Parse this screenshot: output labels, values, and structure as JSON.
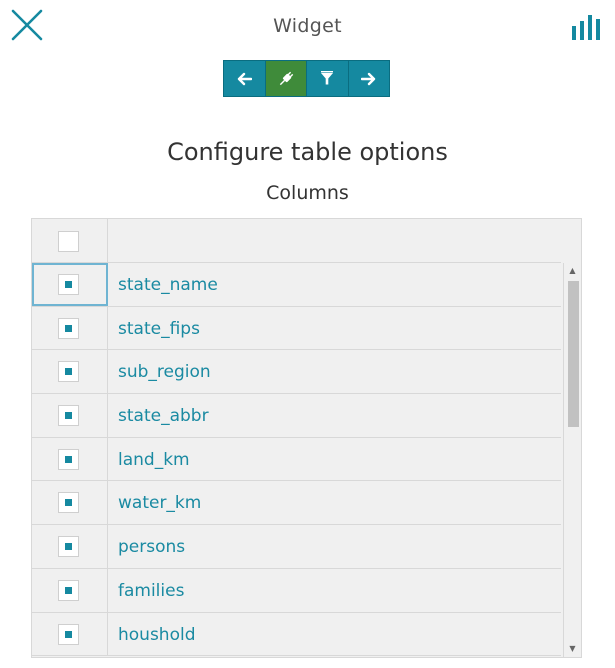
{
  "header": {
    "title": "Widget",
    "close_icon": "close-icon",
    "chart_icon": "bar-chart-icon"
  },
  "toolbar": {
    "buttons": [
      {
        "icon": "arrow-left-icon",
        "active": false
      },
      {
        "icon": "plug-icon",
        "active": true
      },
      {
        "icon": "filter-icon",
        "active": false
      },
      {
        "icon": "arrow-right-icon",
        "active": false
      }
    ]
  },
  "main": {
    "heading": "Configure table options",
    "subheading": "Columns"
  },
  "columns_table": {
    "header_checked": false,
    "rows": [
      {
        "label": "state_name",
        "checked": true
      },
      {
        "label": "state_fips",
        "checked": true
      },
      {
        "label": "sub_region",
        "checked": true
      },
      {
        "label": "state_abbr",
        "checked": true
      },
      {
        "label": "land_km",
        "checked": true
      },
      {
        "label": "water_km",
        "checked": true
      },
      {
        "label": "persons",
        "checked": true
      },
      {
        "label": "families",
        "checked": true
      },
      {
        "label": "houshold",
        "checked": true
      }
    ]
  },
  "colors": {
    "accent": "#1589a0",
    "active_button": "#3f8b3a",
    "link_text": "#1a8aa2"
  }
}
